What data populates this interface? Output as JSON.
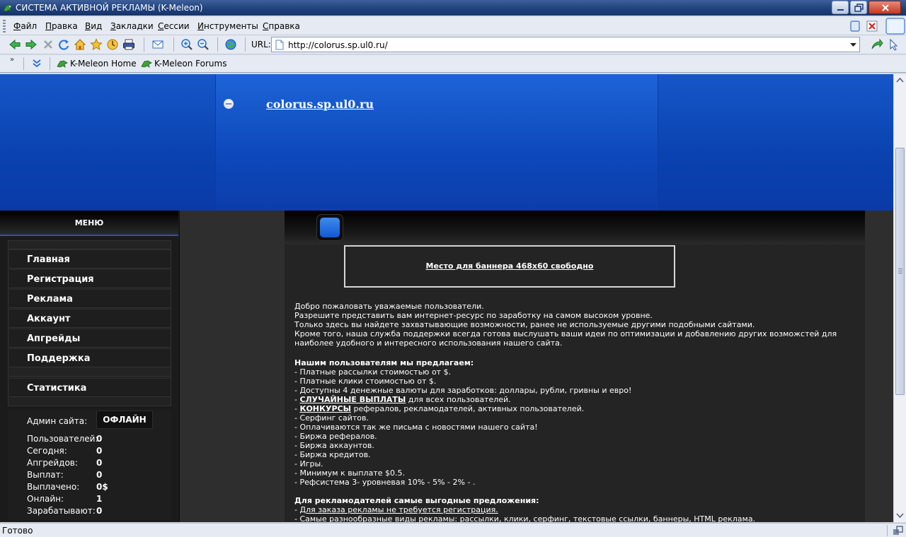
{
  "window": {
    "title": "СИСТЕМА АКТИВНОЙ РЕКЛАМЫ (K-Meleon)"
  },
  "menubar": {
    "items": [
      {
        "pre": "",
        "key": "Ф",
        "post": "айл"
      },
      {
        "pre": "",
        "key": "П",
        "post": "равка"
      },
      {
        "pre": "",
        "key": "В",
        "post": "ид"
      },
      {
        "pre": "",
        "key": "З",
        "post": "акладки"
      },
      {
        "pre": "",
        "key": "С",
        "post": "ессии"
      },
      {
        "pre": "",
        "key": "И",
        "post": "нструменты"
      },
      {
        "pre": "",
        "key": "С",
        "post": "правка"
      }
    ]
  },
  "toolbar": {
    "url_label": "URL:",
    "url": "http://colorus.sp.ul0.ru/"
  },
  "bookmarks": {
    "chevron": "»",
    "items": [
      "K-Meleon Home",
      "K-Meleon Forums"
    ]
  },
  "page": {
    "site_title": "colorus.sp.ul0.ru",
    "menu_heading": "МЕНЮ",
    "nav": [
      "Главная",
      "Регистрация",
      "Реклама",
      "Аккаунт",
      "Апгрейды",
      "Поддержка",
      "Статистика"
    ],
    "admin_label": "Админ сайта:",
    "admin_status": "ОФЛАЙН",
    "stats": [
      {
        "label": "Пользователей:",
        "value": "0"
      },
      {
        "label": "Сегодня:",
        "value": "0"
      },
      {
        "label": "Апгрейдов:",
        "value": "0"
      },
      {
        "label": "Выплат:",
        "value": "0"
      },
      {
        "label": "Выплачено:",
        "value": "0$"
      },
      {
        "label": "Онлайн:",
        "value": "1"
      },
      {
        "label": "Зарабатывают:",
        "value": "0"
      }
    ],
    "ad_banner": "Место для баннера 468x60 свободно",
    "intro": [
      "Добро пожаловать уважаемые пользователи.",
      "Разрешите представить вам интернет-ресурс по заработку на самом высоком уровне.",
      "Только здесь вы найдете захватывающие возможности, ранее не используемые другими подобными сайтами.",
      "Кроме того, наша служба поддержки всегда готова выслушать ваши идеи по оптимизации и добавлению других возможстей для",
      "наиболее удобного и интересного использования нашего сайта."
    ],
    "users_heading": "Нашим пользователям мы предлагаем:",
    "users_list": {
      "l1": "- Платные рассылки стоимостью от $.",
      "l2": "- Платные клики стоимостью от $.",
      "l3": "- Доступны 4 денежные валюты для заработков: доллары, рубли, гривны и евро!",
      "l4_link": "СЛУЧАЙНЫЕ ВЫПЛАТЫ",
      "l4_rest": " для всех пользователей.",
      "l5_link": "КОНКУРСЫ",
      "l5_rest": " рефералов, рекламодателей, активных пользователей.",
      "l6": "- Серфинг сайтов.",
      "l7": "- Оплачиваются так же письма с новостями нашего сайта!",
      "l8": "- Биржа рефералов.",
      "l9": "- Биржа аккаунтов.",
      "l10": "- Биржа кредитов.",
      "l11": "- Игры.",
      "l12": "- Минимум к выплате $0.5.",
      "l13": "- Рефсистема 3- уровневая 10% - 5% - 2% - ."
    },
    "adv_heading": "Для рекламодателей самые выгодные предложения:",
    "adv_list": {
      "l1_link": "Для заказа рекламы не требуется регистрация.",
      "l2": "- Самые разнообразные виды рекламы: рассылки, клики, серфинг, текстовые ссылки, баннеры, HTML реклама."
    }
  },
  "statusbar": {
    "text": "Готово"
  }
}
